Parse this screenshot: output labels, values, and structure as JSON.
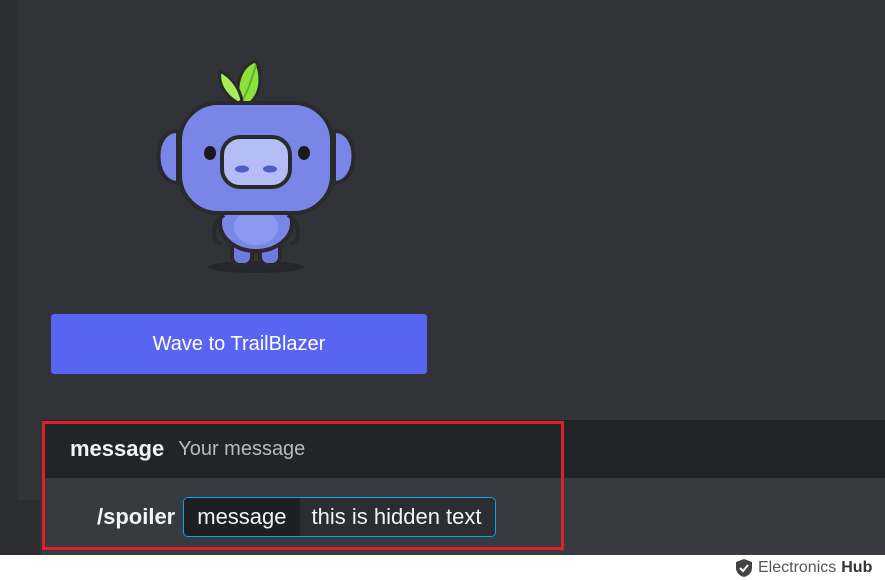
{
  "button": {
    "label": "Wave to TrailBlazer"
  },
  "option": {
    "name": "message",
    "description": "Your message"
  },
  "command": {
    "name": "/spoiler",
    "arg_label": "message",
    "arg_value": "this is hidden text"
  },
  "watermark": {
    "brand": "Electronics",
    "brand_bold": "Hub"
  },
  "colors": {
    "background": "#313338",
    "accent": "#5865f2",
    "focus_outline": "#00a8fc",
    "highlight_box": "#e0202c",
    "mascot_body": "#7986e8",
    "mascot_leaf": "#8ee03a"
  },
  "icons": {
    "mascot": "wumpus-mascot-icon",
    "watermark": "shield-logo-icon"
  }
}
